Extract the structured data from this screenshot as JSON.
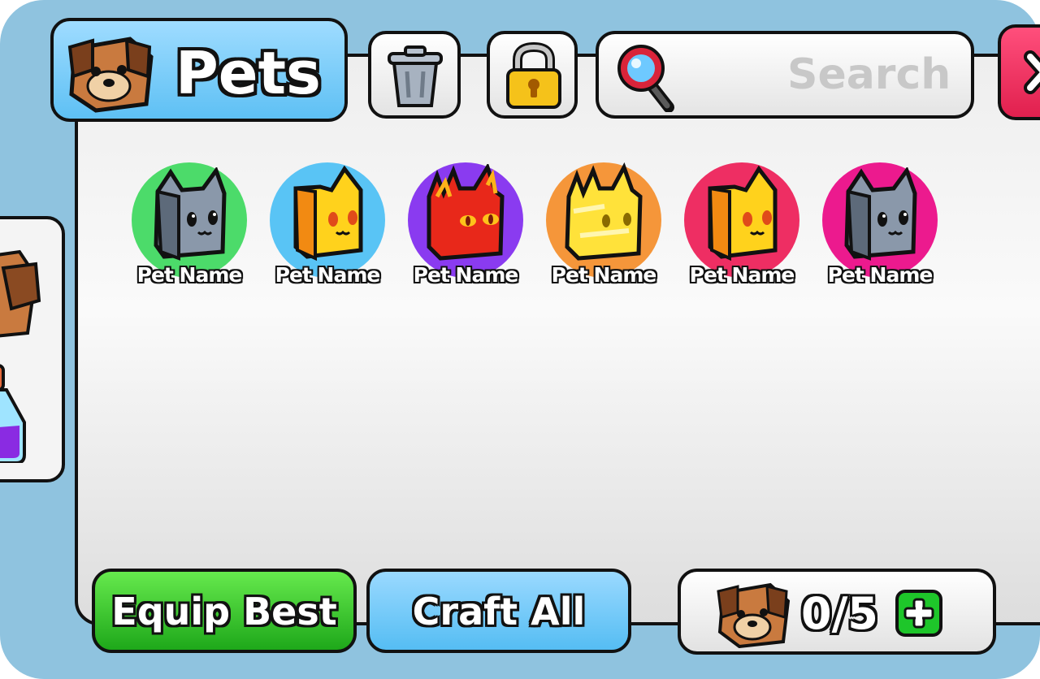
{
  "header": {
    "title": "Pets",
    "icon": "dog-cube-icon",
    "color": "#5ec0f4"
  },
  "toolbar": {
    "trash_icon": "trash-icon",
    "lock_icon": "lock-icon"
  },
  "search": {
    "placeholder": "Search",
    "icon": "magnifier-icon"
  },
  "close": {
    "icon": "close-x-icon",
    "color": "#e1204e"
  },
  "side_tabs": [
    {
      "icon": "dog-cube-icon"
    },
    {
      "icon": "potion-icon"
    }
  ],
  "pets": [
    {
      "name": "Pet Name",
      "bg": "#4cdb6a",
      "kind": "gray-cat"
    },
    {
      "name": "Pet Name",
      "bg": "#59c4f5",
      "kind": "yellow-cat"
    },
    {
      "name": "Pet Name",
      "bg": "#8a3bf0",
      "kind": "fire-cat"
    },
    {
      "name": "Pet Name",
      "bg": "#f5963a",
      "kind": "gold-cat"
    },
    {
      "name": "Pet Name",
      "bg": "#ee2e63",
      "kind": "yellow-cat"
    },
    {
      "name": "Pet Name",
      "bg": "#ec1a8e",
      "kind": "gray-cat"
    }
  ],
  "footer": {
    "equip_label": "Equip Best",
    "craft_label": "Craft All",
    "pet_count": "0/5",
    "add_icon": "plus-icon"
  }
}
